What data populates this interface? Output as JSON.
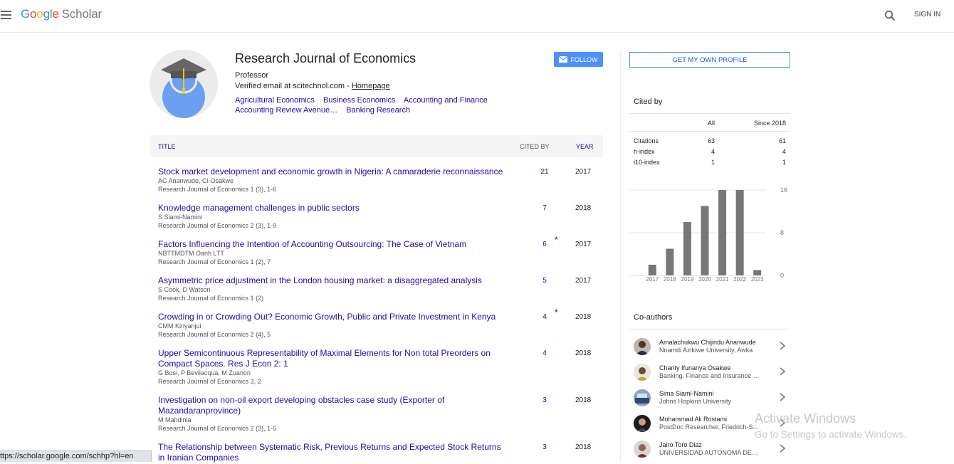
{
  "header": {
    "logo_google_letters": [
      "G",
      "o",
      "o",
      "g",
      "l",
      "e"
    ],
    "logo_scholar": "Scholar",
    "sign_in": "SIGN IN"
  },
  "profile": {
    "name": "Research Journal of Economics",
    "role": "Professor",
    "email_prefix": "Verified email at scitechnol.com - ",
    "homepage": "Homepage",
    "interests": [
      "Agricultural Economics",
      "Business Economics",
      "Accounting and Finance",
      "Accounting Review Avenue…",
      "Banking Research"
    ],
    "follow_label": "FOLLOW"
  },
  "table": {
    "col_title": "TITLE",
    "col_cited": "CITED BY",
    "col_year": "YEAR"
  },
  "articles": [
    {
      "title": "Stock market development and economic growth in Nigeria: A camaraderie reconnaissance",
      "authors": "AC Ananwude, CI Osakwe",
      "venue": "Research Journal of Economics 1 (3), 1-6",
      "cited": "21",
      "star": "",
      "year": "2017"
    },
    {
      "title": "Knowledge management challenges in public sectors",
      "authors": "S Siami-Namini",
      "venue": "Research Journal of Economics 2 (3), 1-9",
      "cited": "7",
      "star": "",
      "year": "2018"
    },
    {
      "title": "Factors Influencing the Intention of Accounting Outsourcing: The Case of Vietnam",
      "authors": "NBTTMDTM Oanh LTT",
      "venue": "Research Journal of Economics 1 (2), 7",
      "cited": "6",
      "star": "*",
      "year": "2017"
    },
    {
      "title": "Asymmetric price adjustment in the London housing market: a disaggregated analysis",
      "authors": "S Cook, D Watson",
      "venue": "Research Journal of Economics 1 (2)",
      "cited": "5",
      "star": "",
      "year": "2017"
    },
    {
      "title": "Crowding in or Crowding Out? Economic Growth, Public and Private Investment in Kenya",
      "authors": "CMM Kinyanjui",
      "venue": "Research Journal of Economics 2 (4), 5",
      "cited": "4",
      "star": "*",
      "year": "2018"
    },
    {
      "title": "Upper Semicontinuous Representability of Maximal Elements for Non total Preorders on Compact Spaces. Res J Econ 2: 1",
      "authors": "G Bosi, P Bevilacqua, M Zuanon",
      "venue": "Research Journal of Economics 3, 2",
      "cited": "4",
      "star": "",
      "year": "2018"
    },
    {
      "title": "Investigation on non-oil export developing obstacles case study (Exporter of Mazandaranprovince)",
      "authors": "M Mahdinia",
      "venue": "Research Journal of Economics 2 (3), 1-5",
      "cited": "3",
      "star": "",
      "year": "2018"
    },
    {
      "title": "The Relationship between Systematic Risk, Previous Returns and Expected Stock Returns in Iranian Companies",
      "authors": "",
      "venue": "",
      "cited": "3",
      "star": "",
      "year": "2018"
    }
  ],
  "sidebar": {
    "get_profile": "GET MY OWN PROFILE",
    "cited_by_title": "Cited by",
    "col_all": "All",
    "col_since": "Since 2018",
    "metrics": [
      {
        "label": "Citations",
        "all": "63",
        "since": "61"
      },
      {
        "label": "h-index",
        "all": "4",
        "since": "4"
      },
      {
        "label": "i10-index",
        "all": "1",
        "since": "1"
      }
    ],
    "coauthors_title": "Co-authors",
    "coauthors": [
      {
        "name": "Amalachukwu Chijindu Ananwude",
        "affiliation": "Nnamdi Azikiwe University, Awka"
      },
      {
        "name": "Charity Ifunanya Osakwe",
        "affiliation": "Banking, Finance and Insurance …"
      },
      {
        "name": "Sima Siami-Namini",
        "affiliation": "Johns Hopkins University"
      },
      {
        "name": "Mohammad Ali Rostami",
        "affiliation": "PostDoc Researcher, Friedrich-S…"
      },
      {
        "name": "Jairo Toro Diaz",
        "affiliation": "UNIVERSIDAD AUTONOMA DE…"
      }
    ]
  },
  "chart_data": {
    "type": "bar",
    "categories": [
      "2017",
      "2018",
      "2019",
      "2020",
      "2021",
      "2022",
      "2023"
    ],
    "values": [
      2,
      5,
      10,
      13,
      16,
      16,
      1
    ],
    "ylim": [
      0,
      16
    ],
    "yticks": [
      "16",
      "8",
      "0"
    ],
    "grid": true,
    "bar_color": "#777777"
  },
  "overlay": {
    "activate_title": "Activate Windows",
    "activate_sub": "Go to Settings to activate Windows.",
    "status_url": "ttps://scholar.google.com/schhp?hl=en"
  }
}
